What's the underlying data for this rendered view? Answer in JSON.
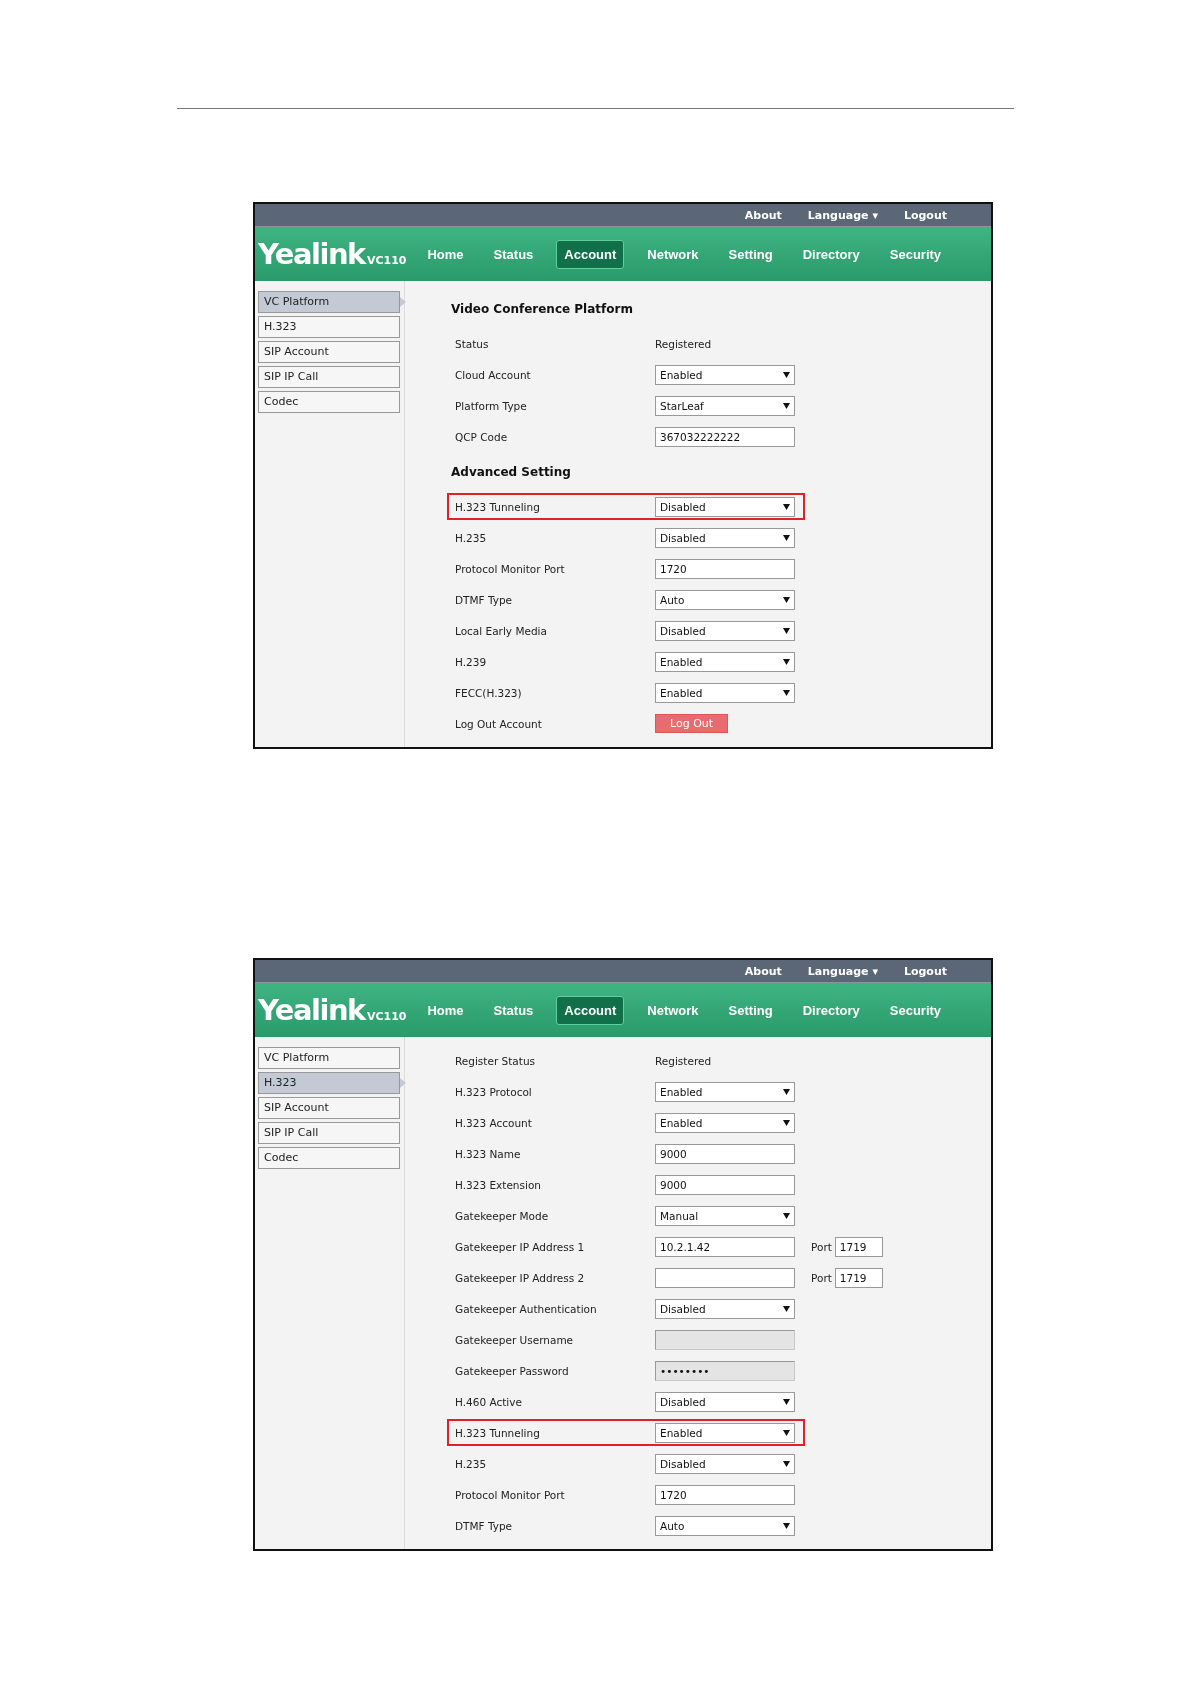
{
  "screens": [
    {
      "topbar_links": [
        "About",
        "Language ▾",
        "Logout"
      ],
      "logo": {
        "brand": "Yealink",
        "model": "VC110"
      },
      "nav": [
        {
          "label": "Home",
          "selected": false
        },
        {
          "label": "Status",
          "selected": false
        },
        {
          "label": "Account",
          "selected": true
        },
        {
          "label": "Network",
          "selected": false
        },
        {
          "label": "Setting",
          "selected": false
        },
        {
          "label": "Directory",
          "selected": false
        },
        {
          "label": "Security",
          "selected": false
        }
      ],
      "sidebar": [
        {
          "label": "VC Platform",
          "selected": true
        },
        {
          "label": "H.323",
          "selected": false
        },
        {
          "label": "SIP Account",
          "selected": false
        },
        {
          "label": "SIP IP Call",
          "selected": false
        },
        {
          "label": "Codec",
          "selected": false
        }
      ],
      "content": [
        {
          "kind": "heading",
          "text": "Video Conference Platform"
        },
        {
          "kind": "text",
          "label": "Status",
          "value": "Registered",
          "highlighted": false
        },
        {
          "kind": "select",
          "label": "Cloud Account",
          "value": "Enabled",
          "highlighted": false
        },
        {
          "kind": "select",
          "label": "Platform Type",
          "value": "StarLeaf",
          "highlighted": false
        },
        {
          "kind": "input",
          "label": "QCP Code",
          "value": "367032222222",
          "highlighted": false
        },
        {
          "kind": "heading",
          "text": "Advanced Setting"
        },
        {
          "kind": "select",
          "label": "H.323 Tunneling",
          "value": "Disabled",
          "highlighted": true
        },
        {
          "kind": "select",
          "label": "H.235",
          "value": "Disabled",
          "highlighted": false
        },
        {
          "kind": "input",
          "label": "Protocol Monitor Port",
          "value": "1720",
          "highlighted": false
        },
        {
          "kind": "select",
          "label": "DTMF Type",
          "value": "Auto",
          "highlighted": false
        },
        {
          "kind": "select",
          "label": "Local Early Media",
          "value": "Disabled",
          "highlighted": false
        },
        {
          "kind": "select",
          "label": "H.239",
          "value": "Enabled",
          "highlighted": false
        },
        {
          "kind": "select",
          "label": "FECC(H.323)",
          "value": "Enabled",
          "highlighted": false
        },
        {
          "kind": "button",
          "label": "Log Out Account",
          "value": "Log Out",
          "highlighted": false
        }
      ]
    },
    {
      "topbar_links": [
        "About",
        "Language ▾",
        "Logout"
      ],
      "logo": {
        "brand": "Yealink",
        "model": "VC110"
      },
      "nav": [
        {
          "label": "Home",
          "selected": false
        },
        {
          "label": "Status",
          "selected": false
        },
        {
          "label": "Account",
          "selected": true
        },
        {
          "label": "Network",
          "selected": false
        },
        {
          "label": "Setting",
          "selected": false
        },
        {
          "label": "Directory",
          "selected": false
        },
        {
          "label": "Security",
          "selected": false
        }
      ],
      "sidebar": [
        {
          "label": "VC Platform",
          "selected": false
        },
        {
          "label": "H.323",
          "selected": true
        },
        {
          "label": "SIP Account",
          "selected": false
        },
        {
          "label": "SIP IP Call",
          "selected": false
        },
        {
          "label": "Codec",
          "selected": false
        }
      ],
      "content": [
        {
          "kind": "text",
          "label": "Register Status",
          "value": "Registered",
          "highlighted": false
        },
        {
          "kind": "select",
          "label": "H.323 Protocol",
          "value": "Enabled",
          "highlighted": false
        },
        {
          "kind": "select",
          "label": "H.323 Account",
          "value": "Enabled",
          "highlighted": false
        },
        {
          "kind": "input",
          "label": "H.323 Name",
          "value": "9000",
          "highlighted": false
        },
        {
          "kind": "input",
          "label": "H.323 Extension",
          "value": "9000",
          "highlighted": false
        },
        {
          "kind": "select",
          "label": "Gatekeeper Mode",
          "value": "Manual",
          "highlighted": false
        },
        {
          "kind": "input_port",
          "label": "Gatekeeper IP Address 1",
          "value": "10.2.1.42",
          "port_label": "Port",
          "port_value": "1719",
          "highlighted": false
        },
        {
          "kind": "input_port",
          "label": "Gatekeeper IP Address 2",
          "port_label": "Port",
          "port_value": "1719",
          "highlighted": false
        },
        {
          "kind": "select",
          "label": "Gatekeeper Authentication",
          "value": "Disabled",
          "highlighted": false
        },
        {
          "kind": "disabled_input",
          "label": "Gatekeeper Username",
          "highlighted": false
        },
        {
          "kind": "disabled_input",
          "label": "Gatekeeper Password",
          "value": "••••••••",
          "highlighted": false
        },
        {
          "kind": "select",
          "label": "H.460 Active",
          "value": "Disabled",
          "highlighted": false
        },
        {
          "kind": "select",
          "label": "H.323 Tunneling",
          "value": "Enabled",
          "highlighted": true
        },
        {
          "kind": "select",
          "label": "H.235",
          "value": "Disabled",
          "highlighted": false
        },
        {
          "kind": "input",
          "label": "Protocol Monitor Port",
          "value": "1720",
          "highlighted": false
        },
        {
          "kind": "select",
          "label": "DTMF Type",
          "value": "Auto",
          "highlighted": false
        }
      ]
    }
  ]
}
